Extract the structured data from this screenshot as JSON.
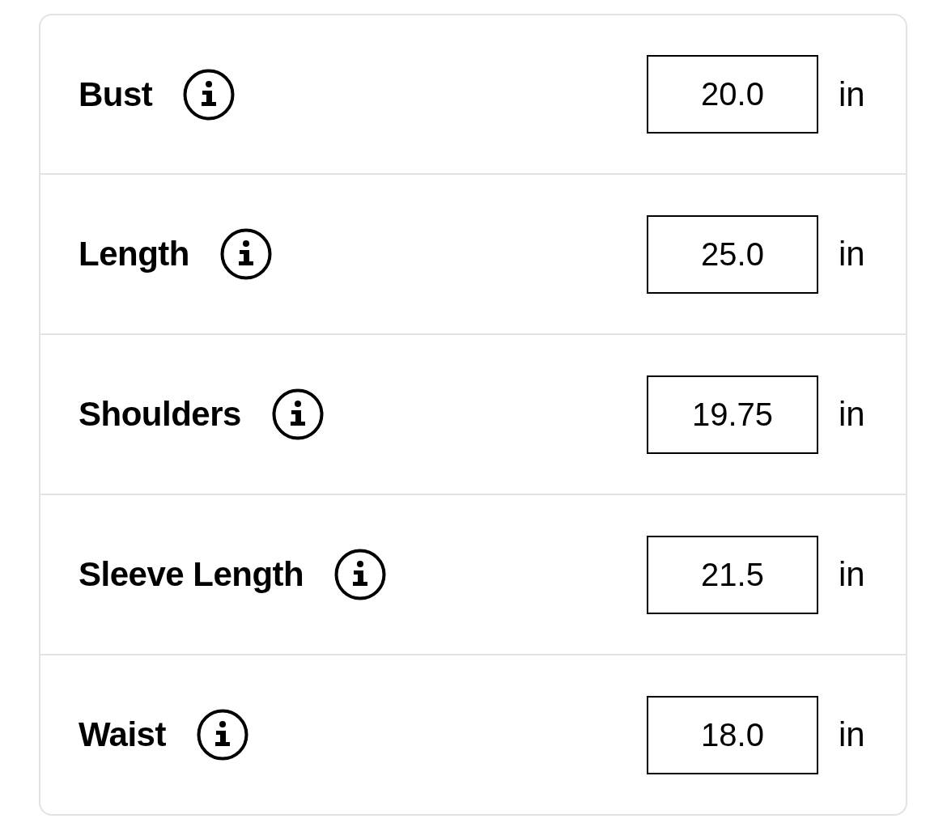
{
  "measurements": [
    {
      "label": "Bust",
      "value": "20.0",
      "unit": "in"
    },
    {
      "label": "Length",
      "value": "25.0",
      "unit": "in"
    },
    {
      "label": "Shoulders",
      "value": "19.75",
      "unit": "in"
    },
    {
      "label": "Sleeve Length",
      "value": "21.5",
      "unit": "in"
    },
    {
      "label": "Waist",
      "value": "18.0",
      "unit": "in"
    }
  ]
}
